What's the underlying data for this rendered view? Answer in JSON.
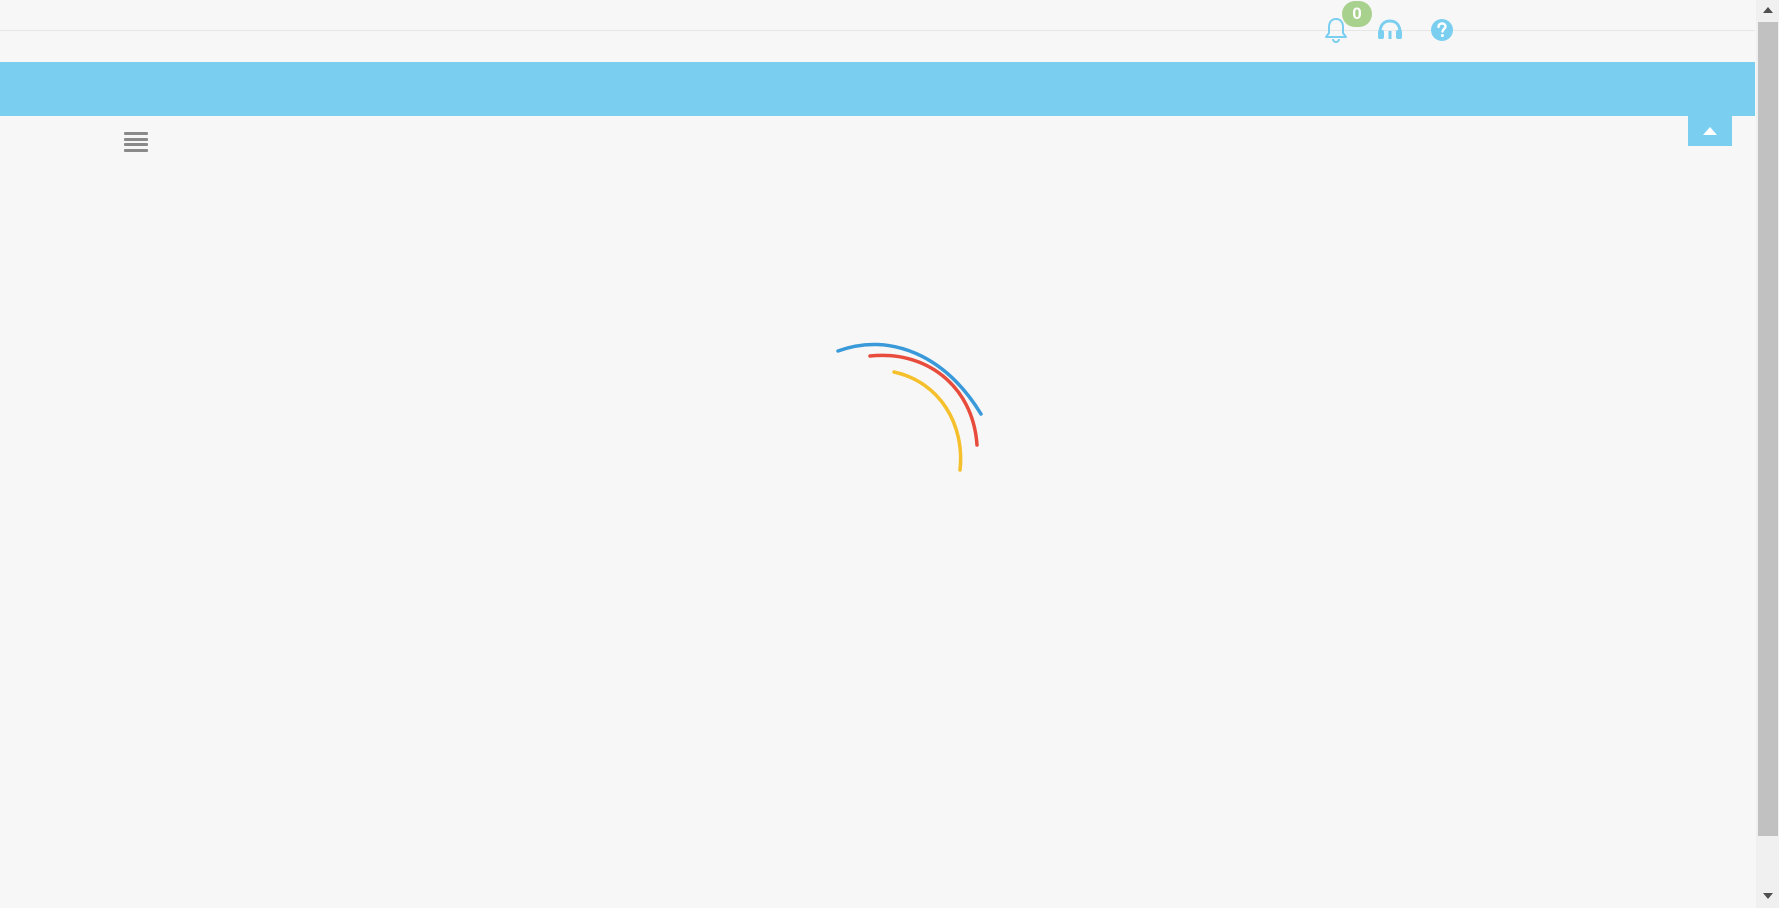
{
  "header": {
    "notifications": {
      "icon": "bell-icon",
      "count": "0"
    },
    "support": {
      "icon": "headset-icon"
    },
    "help": {
      "icon": "help-circle-icon"
    }
  },
  "toolbar": {
    "menu_icon": "hamburger-menu-icon",
    "collapse_icon": "caret-up-icon"
  },
  "loader": {
    "icon": "loading-spinner-icon",
    "arc_colors": [
      "#3a9ad9",
      "#e74c3c",
      "#f5c02b"
    ]
  },
  "colors": {
    "accent": "#7acff1",
    "badge": "#a9d18e",
    "icon": "#7acff1",
    "background": "#f7f7f7"
  }
}
